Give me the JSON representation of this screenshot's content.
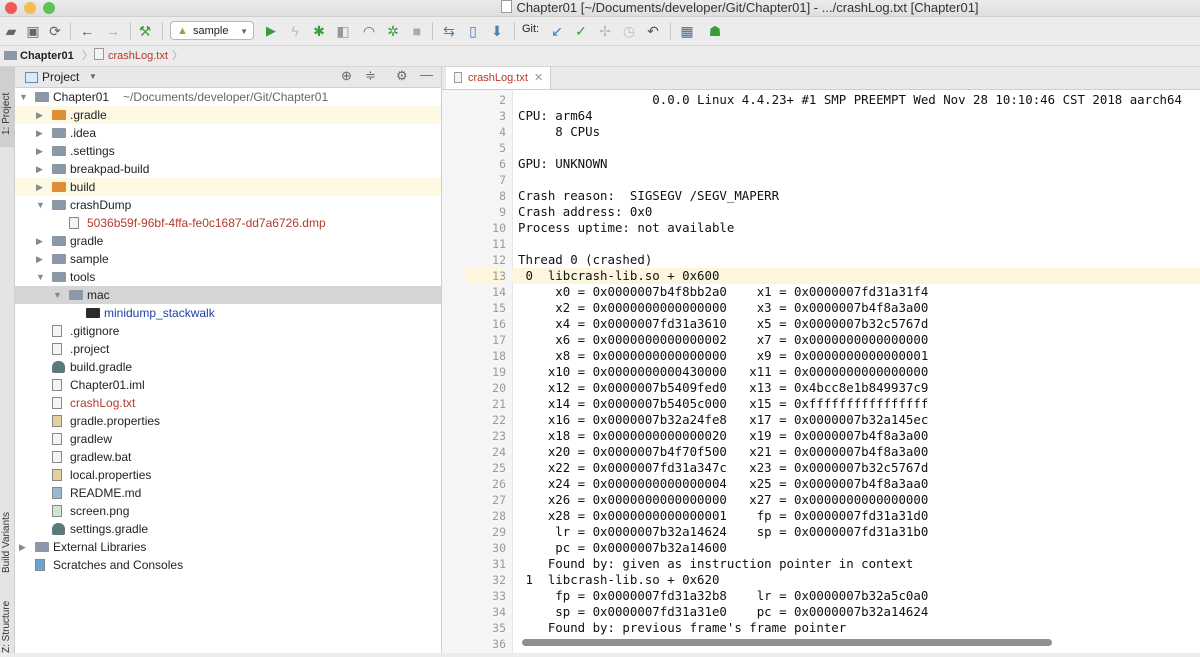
{
  "window": {
    "title": "Chapter01 [~/Documents/developer/Git/Chapter01] - .../crashLog.txt [Chapter01]"
  },
  "toolbar": {
    "run_config": "sample",
    "git_label": "Git:"
  },
  "breadcrumb": {
    "project": "Chapter01",
    "file": "crashLog.txt"
  },
  "side_tabs": {
    "project": "1: Project",
    "build_variants": "Build Variants",
    "structure": "Z: Structure"
  },
  "project_panel": {
    "title": "Project"
  },
  "tree": [
    {
      "label": "Chapter01",
      "extra": "~/Documents/developer/Git/Chapter01",
      "indent": 0,
      "kind": "module",
      "arrow": "open"
    },
    {
      "label": ".gradle",
      "indent": 1,
      "kind": "folder-orange",
      "arrow": "closed",
      "hl": true
    },
    {
      "label": ".idea",
      "indent": 1,
      "kind": "folder",
      "arrow": "closed"
    },
    {
      "label": ".settings",
      "indent": 1,
      "kind": "folder",
      "arrow": "closed"
    },
    {
      "label": "breakpad-build",
      "indent": 1,
      "kind": "folder-lib",
      "arrow": "closed"
    },
    {
      "label": "build",
      "indent": 1,
      "kind": "folder-orange",
      "arrow": "closed",
      "hl": true
    },
    {
      "label": "crashDump",
      "indent": 1,
      "kind": "folder",
      "arrow": "open"
    },
    {
      "label": "5036b59f-96bf-4ffa-fe0c1687-dd7a6726.dmp",
      "indent": 2,
      "kind": "file",
      "arrow": "",
      "red": true
    },
    {
      "label": "gradle",
      "indent": 1,
      "kind": "folder",
      "arrow": "closed"
    },
    {
      "label": "sample",
      "indent": 1,
      "kind": "folder-lib",
      "arrow": "closed"
    },
    {
      "label": "tools",
      "indent": 1,
      "kind": "folder",
      "arrow": "open"
    },
    {
      "label": "mac",
      "indent": 2,
      "kind": "folder",
      "arrow": "open",
      "sel": true
    },
    {
      "label": "minidump_stackwalk",
      "indent": 3,
      "kind": "exec",
      "arrow": "",
      "blue": true
    },
    {
      "label": ".gitignore",
      "indent": 1,
      "kind": "file",
      "arrow": ""
    },
    {
      "label": ".project",
      "indent": 1,
      "kind": "file",
      "arrow": ""
    },
    {
      "label": "build.gradle",
      "indent": 1,
      "kind": "gradle",
      "arrow": ""
    },
    {
      "label": "Chapter01.iml",
      "indent": 1,
      "kind": "file",
      "arrow": ""
    },
    {
      "label": "crashLog.txt",
      "indent": 1,
      "kind": "file",
      "arrow": "",
      "red": true
    },
    {
      "label": "gradle.properties",
      "indent": 1,
      "kind": "props",
      "arrow": ""
    },
    {
      "label": "gradlew",
      "indent": 1,
      "kind": "file",
      "arrow": ""
    },
    {
      "label": "gradlew.bat",
      "indent": 1,
      "kind": "file",
      "arrow": ""
    },
    {
      "label": "local.properties",
      "indent": 1,
      "kind": "props",
      "arrow": ""
    },
    {
      "label": "README.md",
      "indent": 1,
      "kind": "md",
      "arrow": ""
    },
    {
      "label": "screen.png",
      "indent": 1,
      "kind": "img",
      "arrow": ""
    },
    {
      "label": "settings.gradle",
      "indent": 1,
      "kind": "gradle",
      "arrow": ""
    },
    {
      "label": "External Libraries",
      "indent": 0,
      "kind": "libs",
      "arrow": "closed"
    },
    {
      "label": "Scratches and Consoles",
      "indent": 0,
      "kind": "scratch",
      "arrow": ""
    }
  ],
  "editor": {
    "tab_label": "crashLog.txt",
    "first_line": 2,
    "current_line": 13,
    "lines": [
      "                  0.0.0 Linux 4.4.23+ #1 SMP PREEMPT Wed Nov 28 10:10:46 CST 2018 aarch64",
      "CPU: arm64",
      "     8 CPUs",
      "",
      "GPU: UNKNOWN",
      "",
      "Crash reason:  SIGSEGV /SEGV_MAPERR",
      "Crash address: 0x0",
      "Process uptime: not available",
      "",
      "Thread 0 (crashed)",
      " 0  libcrash-lib.so + 0x600",
      "     x0 = 0x0000007b4f8bb2a0    x1 = 0x0000007fd31a31f4",
      "     x2 = 0x0000000000000000    x3 = 0x0000007b4f8a3a00",
      "     x4 = 0x0000007fd31a3610    x5 = 0x0000007b32c5767d",
      "     x6 = 0x0000000000000002    x7 = 0x0000000000000000",
      "     x8 = 0x0000000000000000    x9 = 0x0000000000000001",
      "    x10 = 0x0000000000430000   x11 = 0x0000000000000000",
      "    x12 = 0x0000007b5409fed0   x13 = 0x4bcc8e1b849937c9",
      "    x14 = 0x0000007b5405c000   x15 = 0xffffffffffffffff",
      "    x16 = 0x0000007b32a24fe8   x17 = 0x0000007b32a145ec",
      "    x18 = 0x0000000000000020   x19 = 0x0000007b4f8a3a00",
      "    x20 = 0x0000007b4f70f500   x21 = 0x0000007b4f8a3a00",
      "    x22 = 0x0000007fd31a347c   x23 = 0x0000007b32c5767d",
      "    x24 = 0x0000000000000004   x25 = 0x0000007b4f8a3aa0",
      "    x26 = 0x0000000000000000   x27 = 0x0000000000000000",
      "    x28 = 0x0000000000000001    fp = 0x0000007fd31a31d0",
      "     lr = 0x0000007b32a14624    sp = 0x0000007fd31a31b0",
      "     pc = 0x0000007b32a14600",
      "    Found by: given as instruction pointer in context",
      " 1  libcrash-lib.so + 0x620",
      "     fp = 0x0000007fd31a32b8    lr = 0x0000007b32a5c0a0",
      "     sp = 0x0000007fd31a31e0    pc = 0x0000007b32a14624",
      "    Found by: previous frame's frame pointer",
      ""
    ]
  },
  "colors": {
    "accent": "#3d82d6",
    "highlight_row": "#fdf8e3",
    "selected_row": "#d5d5d5",
    "red_text": "#b43a2a",
    "blue_text": "#1d3fa8",
    "folder": "#8a98a8",
    "orange_folder": "#e08d36",
    "current_line": "#fcf6df"
  }
}
